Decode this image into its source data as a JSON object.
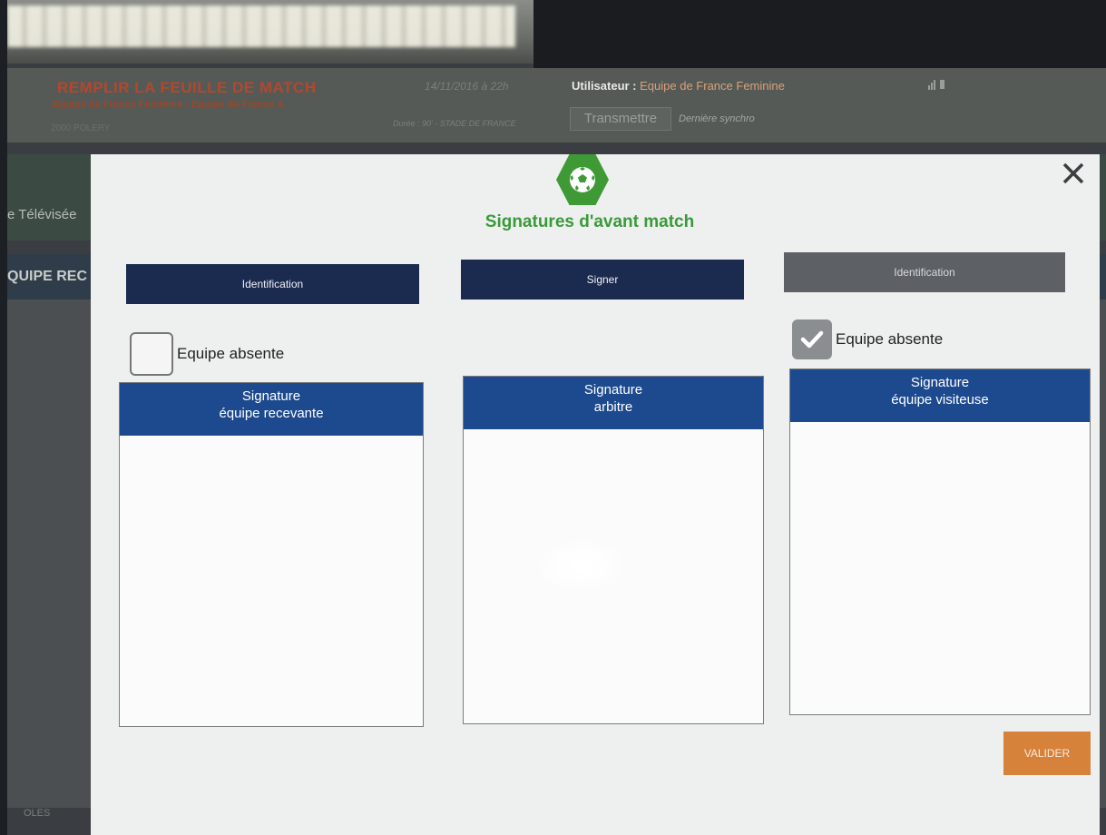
{
  "header": {
    "title": "REMPLIR LA FEUILLE DE MATCH",
    "match": "Equipe de France Féminine - Equipe de France A",
    "city": "2000 POLERY",
    "date": "14/11/2016 à 22h",
    "details": "Durée : 90' - STADE DE FRANCE",
    "user_label": "Utilisateur :",
    "user_name": "Equipe de France Feminine",
    "transmit_label": "Transmettre",
    "sync_label": "Dernière synchro"
  },
  "background": {
    "televise_label": "e Télévisée",
    "equipe_label": "QUIPE REC",
    "bottom_label": "OLES"
  },
  "modal": {
    "title": "Signatures d'avant match",
    "close_symbol": "✕",
    "columns": [
      {
        "header": "Identification",
        "has_absent": true,
        "absent_label": "Equipe absente",
        "absent_checked": false,
        "sig_line1": "Signature",
        "sig_line2": "équipe recevante"
      },
      {
        "header": "Signer",
        "has_absent": false,
        "sig_line1": "Signature",
        "sig_line2": "arbitre"
      },
      {
        "header": "Identification",
        "has_absent": true,
        "absent_label": "Equipe absente",
        "absent_checked": true,
        "sig_line1": "Signature",
        "sig_line2": "équipe visiteuse"
      }
    ],
    "validate_label": "VALIDER"
  },
  "colors": {
    "navy": "#1b2a4f",
    "blue": "#1d4a8e",
    "green": "#3f9a35",
    "orange": "#d7823a",
    "gray_header": "#5d6065"
  }
}
